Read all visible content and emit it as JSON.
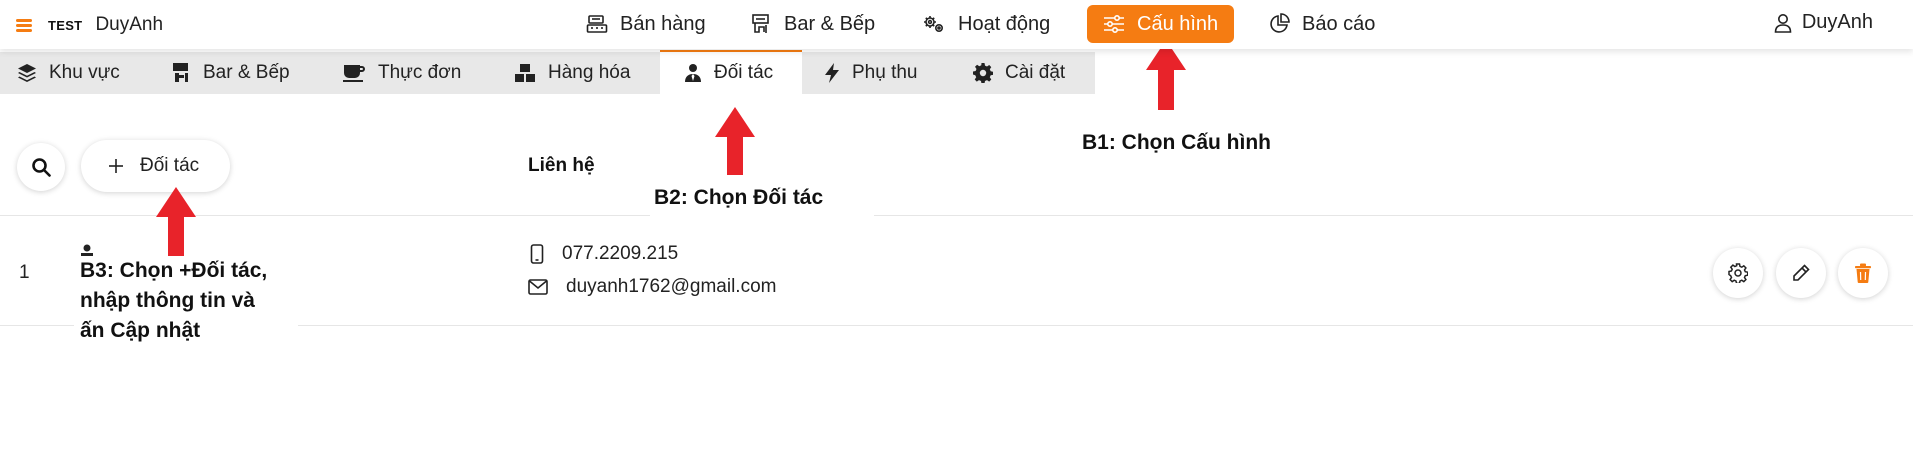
{
  "brand": {
    "store": "TEST",
    "name": "DuyAnh"
  },
  "nav": [
    {
      "label": "Bán hàng",
      "icon": "register-icon"
    },
    {
      "label": "Bar & Bếp",
      "icon": "kitchen-icon"
    },
    {
      "label": "Hoạt động",
      "icon": "gears-icon"
    },
    {
      "label": "Cấu hình",
      "icon": "sliders-icon",
      "active": true
    },
    {
      "label": "Báo cáo",
      "icon": "pie-chart-icon"
    }
  ],
  "user": {
    "name": "DuyAnh"
  },
  "subtabs": [
    {
      "label": "Khu vực",
      "icon": "layers-icon"
    },
    {
      "label": "Bar & Bếp",
      "icon": "kitchen-icon"
    },
    {
      "label": "Thực đơn",
      "icon": "coffee-cup-icon"
    },
    {
      "label": "Hàng hóa",
      "icon": "boxes-icon"
    },
    {
      "label": "Đối tác",
      "icon": "person-tie-icon",
      "active": true
    },
    {
      "label": "Phụ thu",
      "icon": "bolt-icon"
    },
    {
      "label": "Cài đặt",
      "icon": "cog-icon"
    }
  ],
  "toolbar": {
    "add_partner_label": "Đối tác"
  },
  "table": {
    "contact_header": "Liên hệ",
    "rows": [
      {
        "index": "1",
        "phone": "077.2209.215",
        "email": "duyanh1762@gmail.com"
      }
    ]
  },
  "annotations": {
    "step1": "B1: Chọn Cấu hình",
    "step2": "B2: Chọn Đối tác",
    "step3_line1": "B3: Chọn +Đối tác,",
    "step3_line2": "nhập thông tin và",
    "step3_line3": "ấn Cập nhật"
  },
  "colors": {
    "accent": "#f57c12",
    "annotation_arrow": "#e8232a",
    "delete": "#f57c12"
  }
}
